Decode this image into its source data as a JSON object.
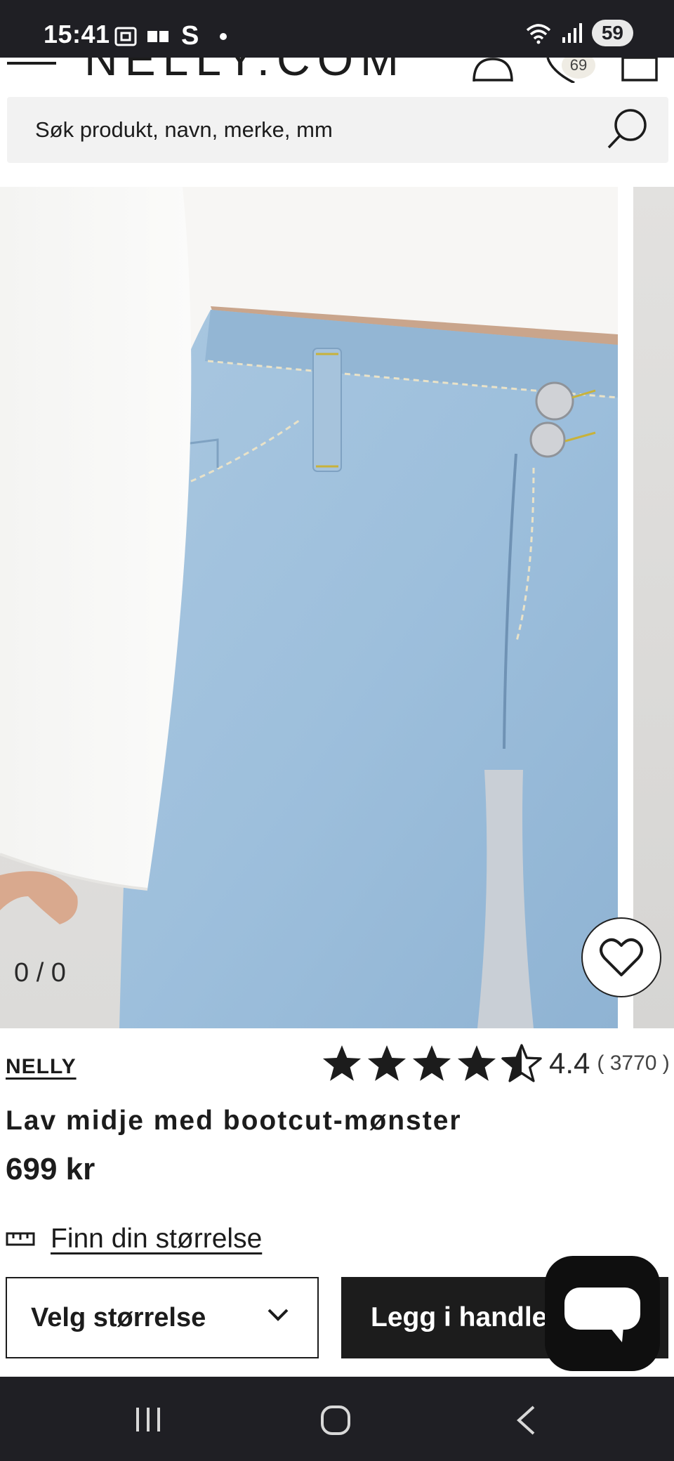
{
  "status_bar": {
    "time": "15:41",
    "carrier_letter": "S",
    "battery": "59"
  },
  "header": {
    "logo": "NELLY.COM",
    "wishlist_count": "69"
  },
  "search": {
    "placeholder": "Søk produkt, navn, merke, mm"
  },
  "gallery": {
    "counter": "0 / 0"
  },
  "product": {
    "brand": "NELLY",
    "rating": 4.4,
    "rating_value": "4.4",
    "rating_count": "( 3770 )",
    "title": "Lav midje med bootcut-mønster",
    "price": "699 kr"
  },
  "size_guide": {
    "label": "Finn din størrelse"
  },
  "actions": {
    "size_select_label": "Velg størrelse",
    "add_to_cart_label": "Legg i handlekurv"
  },
  "colors": {
    "dark": "#1c1c1c",
    "system_bar": "#1f1f24",
    "search_bg": "#f2f2f2",
    "denim": "#9dbfdc"
  },
  "icons": {
    "menu": "hamburger-icon",
    "user": "user-icon",
    "wishlist": "heart-icon",
    "bag": "bag-icon",
    "search": "search-icon",
    "size_guide": "ruler-icon",
    "chat": "chat-icon"
  }
}
